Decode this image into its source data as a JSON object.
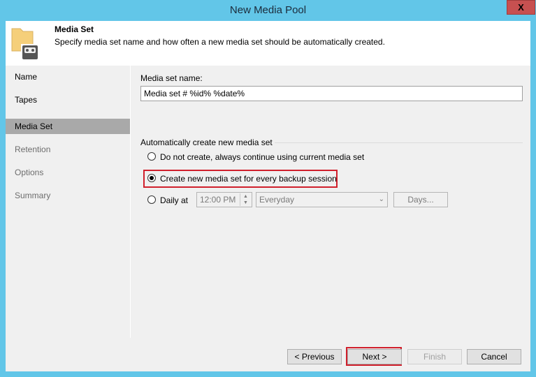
{
  "window": {
    "title": "New Media Pool",
    "close_label": "X"
  },
  "header": {
    "title": "Media Set",
    "description": "Specify media set name and how often a new media set should be automatically created."
  },
  "sidebar": {
    "items": [
      {
        "label": "Name"
      },
      {
        "label": "Tapes"
      },
      {
        "label": "Media Set",
        "selected": true
      },
      {
        "label": "Retention"
      },
      {
        "label": "Options"
      },
      {
        "label": "Summary"
      }
    ]
  },
  "form": {
    "name_label": "Media set name:",
    "name_value": "Media set # %id% %date%",
    "group_label": "Automatically create new media set",
    "options": [
      {
        "label": "Do not create, always continue using current media set",
        "checked": false
      },
      {
        "label": "Create new media set for every backup session",
        "checked": true
      },
      {
        "label": "Daily at",
        "checked": false
      }
    ],
    "time_value": "12:00 PM",
    "schedule_value": "Everyday",
    "days_label": "Days..."
  },
  "buttons": {
    "previous": "< Previous",
    "next": "Next >",
    "finish": "Finish",
    "cancel": "Cancel"
  },
  "colors": {
    "titlebar": "#62c6e8",
    "highlight": "#d0202c",
    "close": "#c75050"
  }
}
